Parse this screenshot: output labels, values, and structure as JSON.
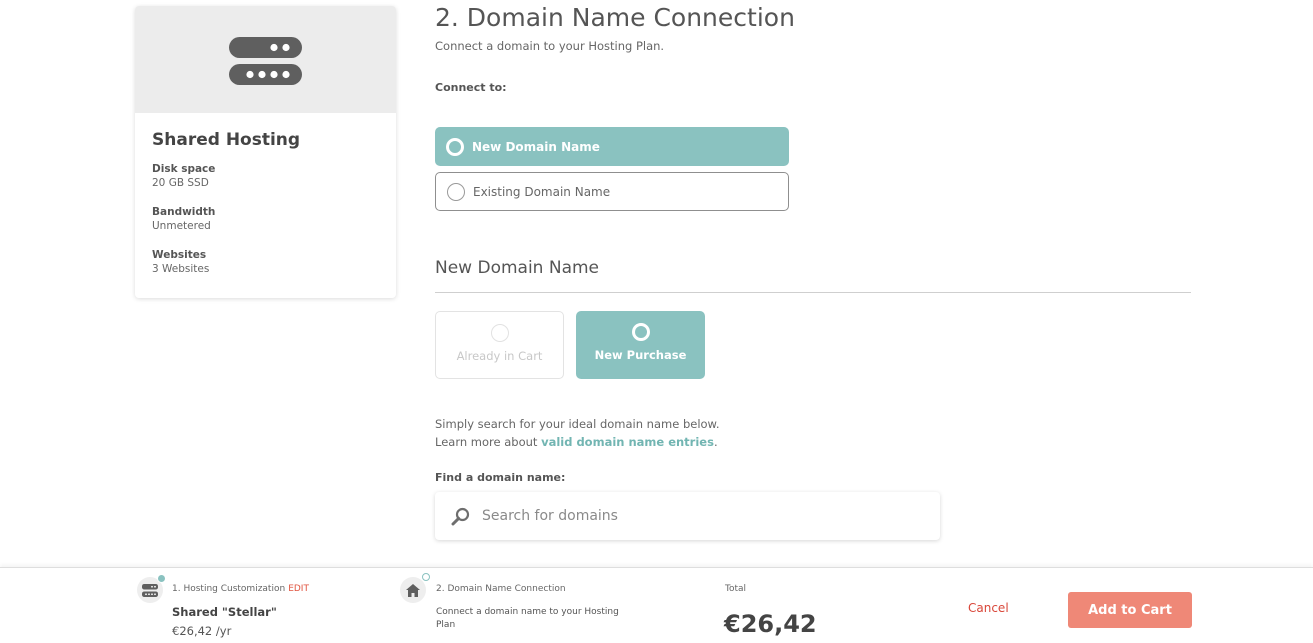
{
  "product_card": {
    "icon": "server-icon",
    "title": "Shared Hosting",
    "specs": [
      {
        "label": "Disk space",
        "value": "20 GB SSD"
      },
      {
        "label": "Bandwidth",
        "value": "Unmetered"
      },
      {
        "label": "Websites",
        "value": "3 Websites"
      }
    ]
  },
  "main": {
    "title": "2. Domain Name Connection",
    "subtitle": "Connect a domain to your Hosting Plan.",
    "connect_label": "Connect to:",
    "connect_options": [
      {
        "label": "New Domain Name",
        "selected": true
      },
      {
        "label": "Existing Domain Name",
        "selected": false
      }
    ],
    "section_title": "New Domain Name",
    "purchase_options": [
      {
        "label": "Already in Cart",
        "disabled": true
      },
      {
        "label": "New Purchase",
        "selected": true
      }
    ],
    "help_line1": "Simply search for your ideal domain name below.",
    "help_line2_prefix": "Learn more about ",
    "help_link": "valid domain name entries",
    "help_line2_suffix": ".",
    "find_label": "Find a domain name:",
    "search": {
      "placeholder": "Search for domains",
      "value": "",
      "icon": "search-icon"
    }
  },
  "bottom_bar": {
    "step1": {
      "label": "1. Hosting Customization",
      "edit_label": "EDIT",
      "name": "Shared \"Stellar\"",
      "price": "€26,42 /yr",
      "icon": "server-icon"
    },
    "step2": {
      "label": "2. Domain Name Connection",
      "description": "Connect a domain name to your Hosting Plan",
      "icon": "home-icon"
    },
    "total_label": "Total",
    "total_value": "€26,42",
    "cancel_label": "Cancel",
    "add_to_cart_label": "Add to Cart"
  },
  "colors": {
    "accent_teal": "#8ac2c0",
    "link_teal": "#72b5b2",
    "cta_salmon": "#ef8877",
    "cancel_red": "#d9473a"
  }
}
